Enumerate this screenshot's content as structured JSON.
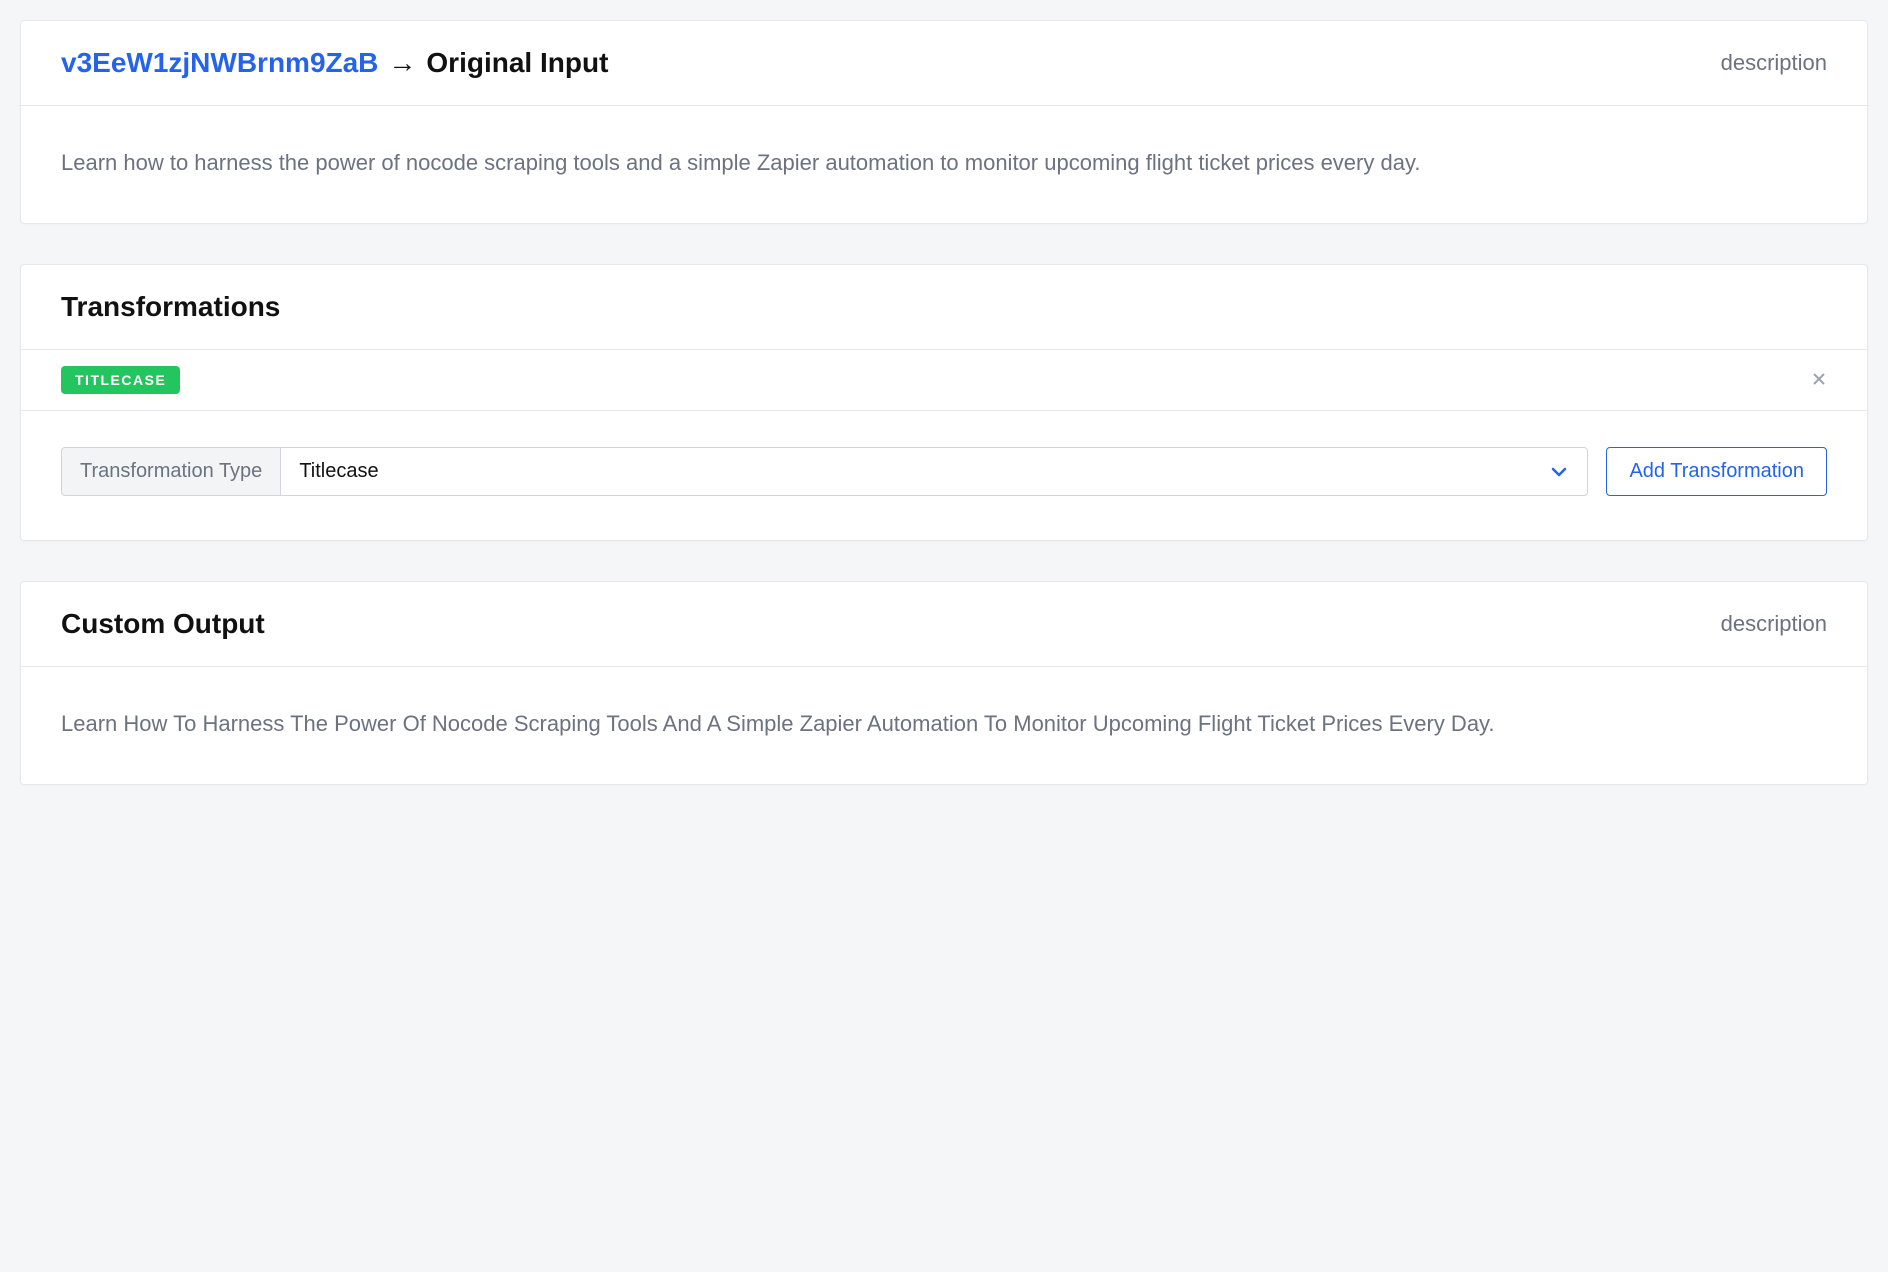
{
  "original_input": {
    "breadcrumb_id": "v3EeW1zjNWBrnm9ZaB",
    "breadcrumb_arrow": "→",
    "breadcrumb_title": "Original Input",
    "description_label": "description",
    "body": "Learn how to harness the power of nocode scraping tools and a simple Zapier automation to monitor upcoming flight ticket prices every day."
  },
  "transformations": {
    "title": "Transformations",
    "pill": "TITLECASE",
    "form_label": "Transformation Type",
    "select_value": "Titlecase",
    "add_button": "Add Transformation"
  },
  "custom_output": {
    "title": "Custom Output",
    "description_label": "description",
    "body": "Learn How To Harness The Power Of Nocode Scraping Tools And A Simple Zapier Automation To Monitor Upcoming Flight Ticket Prices Every Day."
  }
}
